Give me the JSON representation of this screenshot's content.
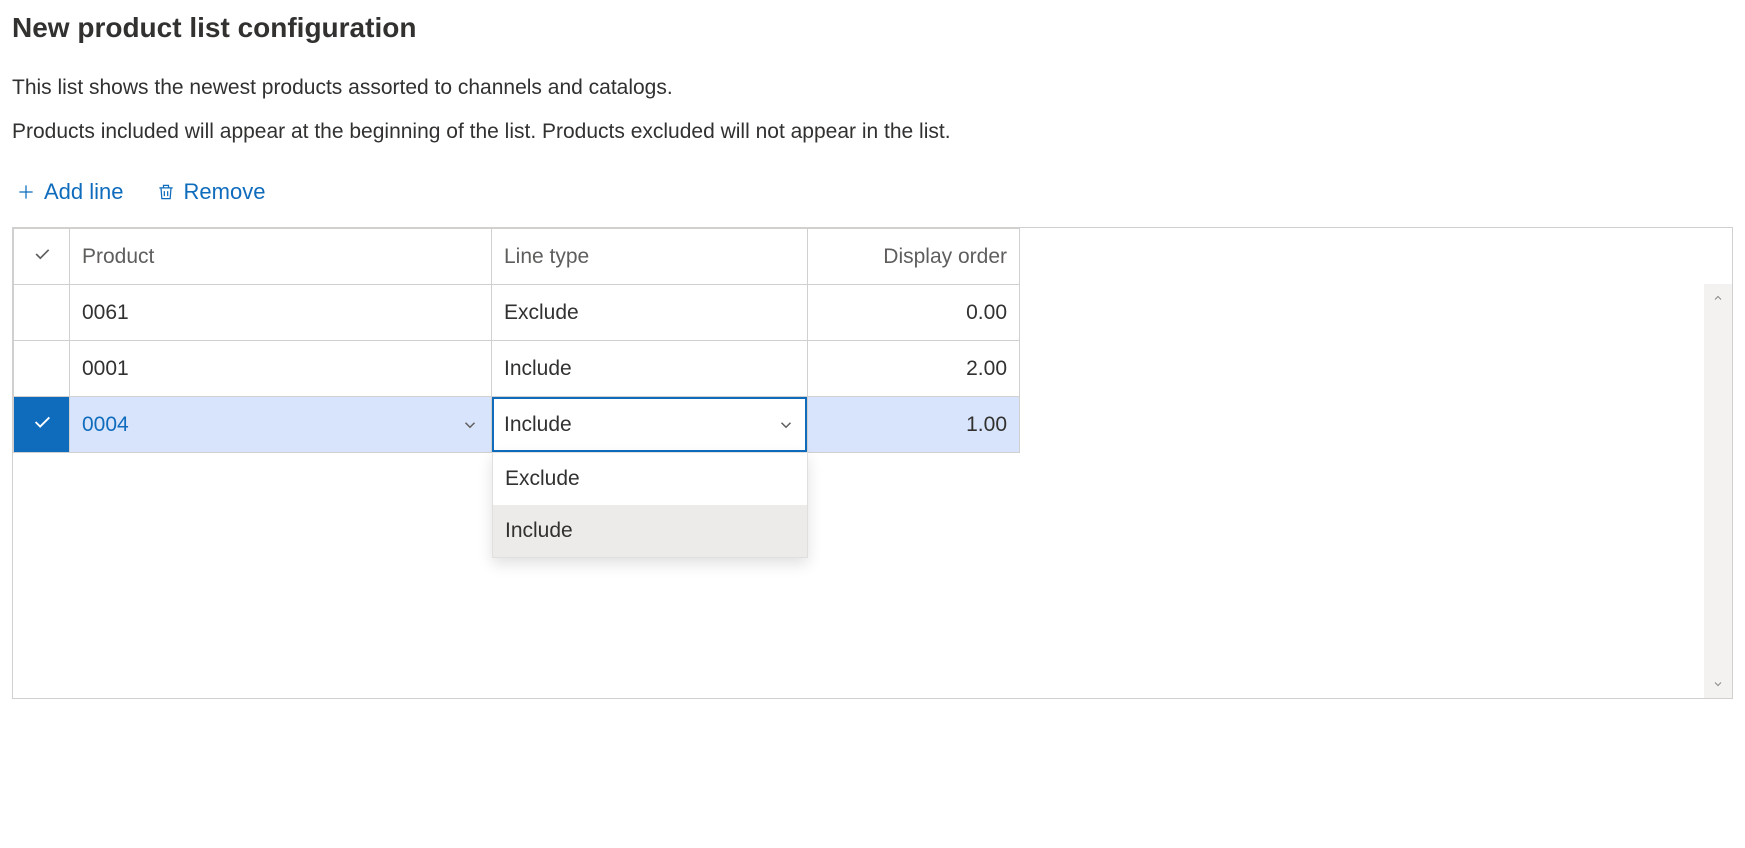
{
  "title": "New product list configuration",
  "description1": "This list shows the newest products assorted to channels and catalogs.",
  "description2": "Products included will appear at the beginning of the list. Products excluded will not appear in the list.",
  "toolbar": {
    "add_label": "Add line",
    "remove_label": "Remove"
  },
  "columns": {
    "product": "Product",
    "line_type": "Line type",
    "display_order": "Display order"
  },
  "rows": [
    {
      "product": "0061",
      "line_type": "Exclude",
      "display_order": "0.00",
      "selected": false
    },
    {
      "product": "0001",
      "line_type": "Include",
      "display_order": "2.00",
      "selected": false
    },
    {
      "product": "0004",
      "line_type": "Include",
      "display_order": "1.00",
      "selected": true
    }
  ],
  "dropdown": {
    "options": [
      "Exclude",
      "Include"
    ],
    "highlighted": "Include"
  }
}
